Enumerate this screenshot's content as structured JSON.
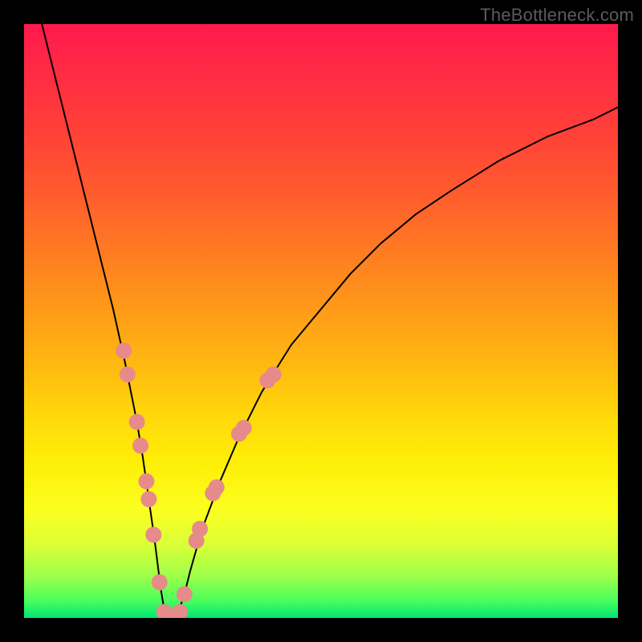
{
  "watermark": "TheBottleneck.com",
  "chart_data": {
    "type": "line",
    "title": "",
    "xlabel": "",
    "ylabel": "",
    "xlim": [
      0,
      100
    ],
    "ylim": [
      0,
      100
    ],
    "grid": false,
    "legend": false,
    "series": [
      {
        "name": "curve",
        "color": "#000000",
        "x": [
          3,
          5,
          7,
          9,
          11,
          13,
          15,
          17,
          18,
          19,
          20,
          21,
          22,
          22.5,
          23,
          23.5,
          24,
          25,
          26,
          27,
          28,
          30,
          33,
          36,
          40,
          45,
          50,
          55,
          60,
          66,
          72,
          80,
          88,
          96,
          100
        ],
        "y": [
          100,
          92,
          84,
          76,
          68,
          60,
          52,
          43,
          38,
          33,
          27,
          20,
          13,
          9,
          5,
          2,
          0,
          0,
          1,
          4,
          8,
          15,
          23,
          30,
          38,
          46,
          52,
          58,
          63,
          68,
          72,
          77,
          81,
          84,
          86
        ]
      }
    ],
    "markers": [
      {
        "name": "dots",
        "color": "#e78a8a",
        "points": [
          {
            "x": 16.8,
            "y": 45
          },
          {
            "x": 17.4,
            "y": 41
          },
          {
            "x": 19.0,
            "y": 33
          },
          {
            "x": 19.6,
            "y": 29
          },
          {
            "x": 20.6,
            "y": 23
          },
          {
            "x": 21.0,
            "y": 20
          },
          {
            "x": 21.8,
            "y": 14
          },
          {
            "x": 22.8,
            "y": 6
          },
          {
            "x": 23.6,
            "y": 1
          },
          {
            "x": 24.4,
            "y": 0
          },
          {
            "x": 25.4,
            "y": 0
          },
          {
            "x": 26.2,
            "y": 1
          },
          {
            "x": 27.0,
            "y": 4
          },
          {
            "x": 29.0,
            "y": 13
          },
          {
            "x": 29.6,
            "y": 15
          },
          {
            "x": 31.8,
            "y": 21
          },
          {
            "x": 32.4,
            "y": 22
          },
          {
            "x": 36.2,
            "y": 31
          },
          {
            "x": 37.0,
            "y": 32
          },
          {
            "x": 41.0,
            "y": 40
          },
          {
            "x": 42.0,
            "y": 41
          }
        ]
      }
    ]
  }
}
